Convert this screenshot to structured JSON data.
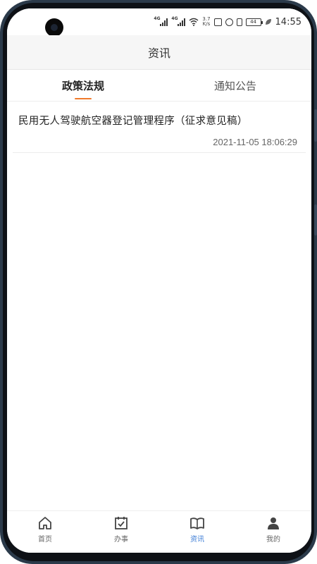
{
  "status_bar": {
    "network_1": "4G",
    "network_2": "4G",
    "speed_value": "3.7",
    "speed_unit": "K/s",
    "battery": "44",
    "time": "14:55"
  },
  "header": {
    "title": "资讯"
  },
  "tabs": [
    {
      "label": "政策法规",
      "active": true
    },
    {
      "label": "通知公告",
      "active": false
    }
  ],
  "news": [
    {
      "title": "民用无人驾驶航空器登记管理程序（征求意见稿）",
      "time": "2021-11-05 18:06:29"
    }
  ],
  "bottom_nav": [
    {
      "label": "首页",
      "icon": "home-icon",
      "active": false
    },
    {
      "label": "办事",
      "icon": "calendar-check-icon",
      "active": false
    },
    {
      "label": "资讯",
      "icon": "book-icon",
      "active": true
    },
    {
      "label": "我的",
      "icon": "user-icon",
      "active": false
    }
  ],
  "colors": {
    "accent": "#f07a2b",
    "active_nav": "#3a7bd5"
  }
}
